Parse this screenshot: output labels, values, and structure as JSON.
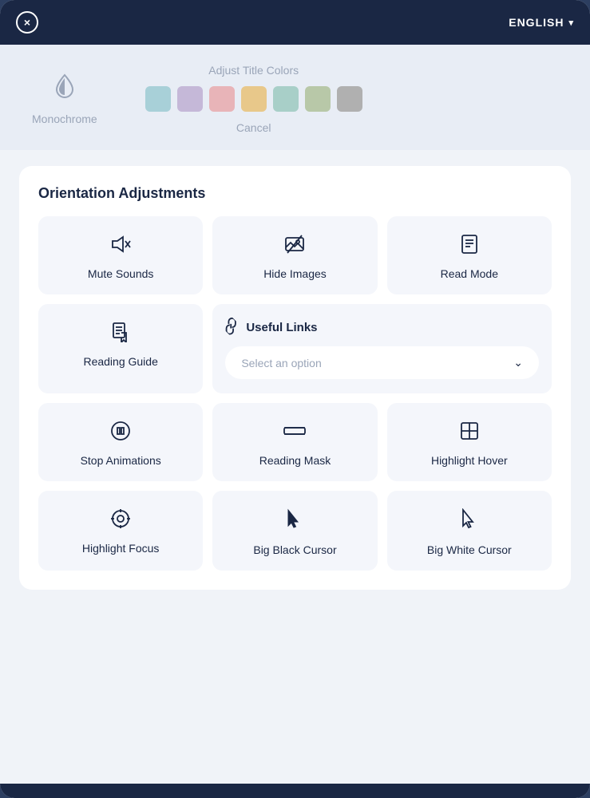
{
  "topBar": {
    "closeLabel": "×",
    "langLabel": "ENGLISH",
    "langChevron": "▾"
  },
  "colorSection": {
    "monochromeLabel": "Monochrome",
    "adjustTitleLabel": "Adjust Title Colors",
    "cancelLabel": "Cancel",
    "swatches": [
      {
        "color": "#a8d0d8",
        "name": "teal-swatch"
      },
      {
        "color": "#c5b8d8",
        "name": "purple-swatch"
      },
      {
        "color": "#e8b4b8",
        "name": "pink-swatch"
      },
      {
        "color": "#e8c88a",
        "name": "yellow-swatch"
      },
      {
        "color": "#a8cfc8",
        "name": "green-teal-swatch"
      },
      {
        "color": "#b8c8a8",
        "name": "green-swatch"
      },
      {
        "color": "#b0b0b0",
        "name": "gray-swatch"
      }
    ]
  },
  "panel": {
    "title": "Orientation Adjustments",
    "items": [
      {
        "id": "mute-sounds",
        "label": "Mute Sounds",
        "icon": "🔇"
      },
      {
        "id": "hide-images",
        "label": "Hide Images",
        "icon": "🖼"
      },
      {
        "id": "read-mode",
        "label": "Read Mode",
        "icon": "📋"
      },
      {
        "id": "reading-guide",
        "label": "Reading Guide",
        "icon": "☝"
      },
      {
        "id": "stop-animations",
        "label": "Stop Animations",
        "icon": "⏸"
      },
      {
        "id": "reading-mask",
        "label": "Reading Mask",
        "icon": "▬"
      },
      {
        "id": "highlight-hover",
        "label": "Highlight Hover",
        "icon": "⊞"
      },
      {
        "id": "highlight-focus",
        "label": "Highlight Focus",
        "icon": "⊕"
      },
      {
        "id": "big-black-cursor",
        "label": "Big Black Cursor",
        "icon": "👆"
      },
      {
        "id": "big-white-cursor",
        "label": "Big White Cursor",
        "icon": "👆"
      }
    ],
    "usefulLinks": {
      "label": "Useful Links",
      "selectPlaceholder": "Select an option",
      "chevron": "⌄"
    }
  }
}
